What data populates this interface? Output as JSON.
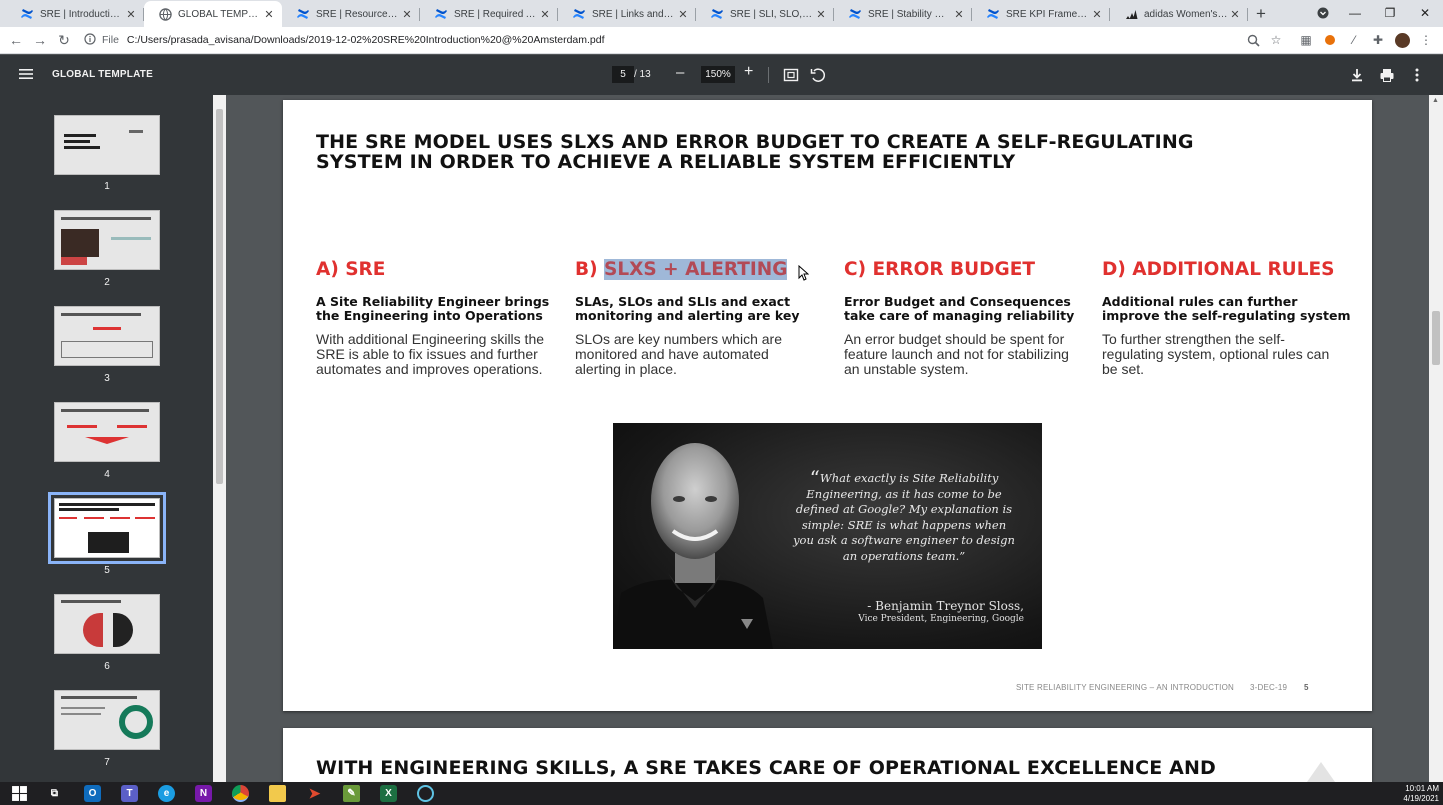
{
  "browser": {
    "tabs": [
      {
        "title": "SRE | Introduction for ...",
        "icon": "confluence-icon",
        "active": false
      },
      {
        "title": "GLOBAL TEMPLATE",
        "icon": "globe-icon",
        "active": true
      },
      {
        "title": "SRE | Resources to und...",
        "icon": "confluence-icon",
        "active": false
      },
      {
        "title": "SRE | Required Access",
        "icon": "confluence-icon",
        "active": false
      },
      {
        "title": "SRE | Links and useful ...",
        "icon": "confluence-icon",
        "active": false
      },
      {
        "title": "SRE | SLI, SLO, Error Bu...",
        "icon": "confluence-icon",
        "active": false
      },
      {
        "title": "SRE | Stability Metrics",
        "icon": "confluence-icon",
        "active": false
      },
      {
        "title": "SRE KPI Framework - E...",
        "icon": "confluence-icon",
        "active": false
      },
      {
        "title": "adidas Women's Origi...",
        "icon": "adidas-icon",
        "active": false
      }
    ],
    "address_label": "File",
    "url": "C:/Users/prasada_avisana/Downloads/2019-12-02%20SRE%20Introduction%20@%20Amsterdam.pdf"
  },
  "pdf_toolbar": {
    "title": "GLOBAL TEMPLATE",
    "current_page": "5",
    "total_pages": "/ 13",
    "zoom": "150%"
  },
  "thumbnails": [
    {
      "num": "1"
    },
    {
      "num": "2"
    },
    {
      "num": "3"
    },
    {
      "num": "4"
    },
    {
      "num": "5",
      "selected": true
    },
    {
      "num": "6"
    },
    {
      "num": "7"
    }
  ],
  "slide": {
    "title_line1": "THE SRE MODEL USES SLXS AND ERROR BUDGET TO CREATE A SELF-REGULATING",
    "title_line2": "SYSTEM IN ORDER TO ACHIEVE A RELIABLE SYSTEM EFFICIENTLY",
    "columns": [
      {
        "prefix": "A) ",
        "heading": "SRE",
        "sub1": "A Site Reliability Engineer brings",
        "sub2": "the Engineering into Operations",
        "body1": "With additional Engineering skills the",
        "body2": "SRE is able to fix issues and further",
        "body3": "automates and improves operations."
      },
      {
        "prefix": "B) ",
        "heading": "SLXS + ALERTING",
        "sub1": "SLAs, SLOs and SLIs and exact",
        "sub2": "monitoring and alerting are key",
        "body1": "SLOs are key numbers which are",
        "body2": "monitored and have automated",
        "body3": "alerting in place."
      },
      {
        "prefix": "C) ",
        "heading": "ERROR BUDGET",
        "sub1": "Error Budget and Consequences",
        "sub2": "take care of managing reliability",
        "body1": "An error budget should be spent for",
        "body2": "feature launch and not for stabilizing",
        "body3": "an unstable system."
      },
      {
        "prefix": "D) ",
        "heading": "ADDITIONAL RULES",
        "sub1": "Additional rules can further",
        "sub2": "improve the self-regulating system",
        "body1": "To further strengthen the self-",
        "body2": "regulating system, optional rules can",
        "body3": "be set."
      }
    ],
    "quote_mark": "“",
    "quote_lines": [
      "What exactly is Site Reliability",
      "Engineering, as it has come to be",
      "defined at Google? My explanation is",
      "simple: SRE is what happens when",
      "you ask a software engineer to design",
      "an operations team.”"
    ],
    "author": "- Benjamin Treynor Sloss,",
    "author_role": "Vice President, Engineering, Google",
    "footer_title": "SITE RELIABILITY ENGINEERING – AN INTRODUCTION",
    "footer_date": "3-DEC-19",
    "footer_page": "5"
  },
  "next_slide": {
    "title_line1": "WITH ENGINEERING SKILLS, A SRE TAKES CARE OF OPERATIONAL EXCELLENCE AND"
  },
  "taskbar": {
    "time": "10:01 AM",
    "date": "4/19/2021"
  },
  "colors": {
    "accent_red": "#e0312f",
    "highlight": "#9fb8d8",
    "pdf_toolbar": "#323639",
    "viewer_bg": "#525659"
  }
}
